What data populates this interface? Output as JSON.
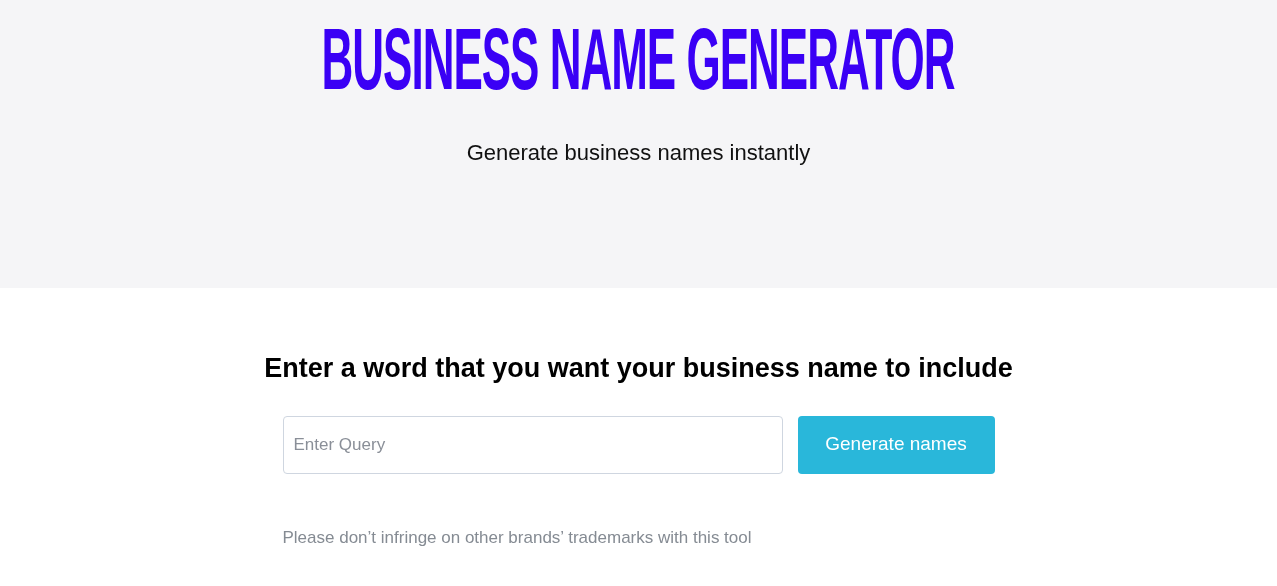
{
  "hero": {
    "title": "BUSINESS NAME GENERATOR",
    "subtitle": "Generate business names instantly"
  },
  "form": {
    "heading": "Enter a word that you want your business name to include",
    "query": {
      "placeholder": "Enter Query"
    },
    "button": "Generate names",
    "note": "Please don’t infringe on other brands’ trademarks with this tool"
  }
}
